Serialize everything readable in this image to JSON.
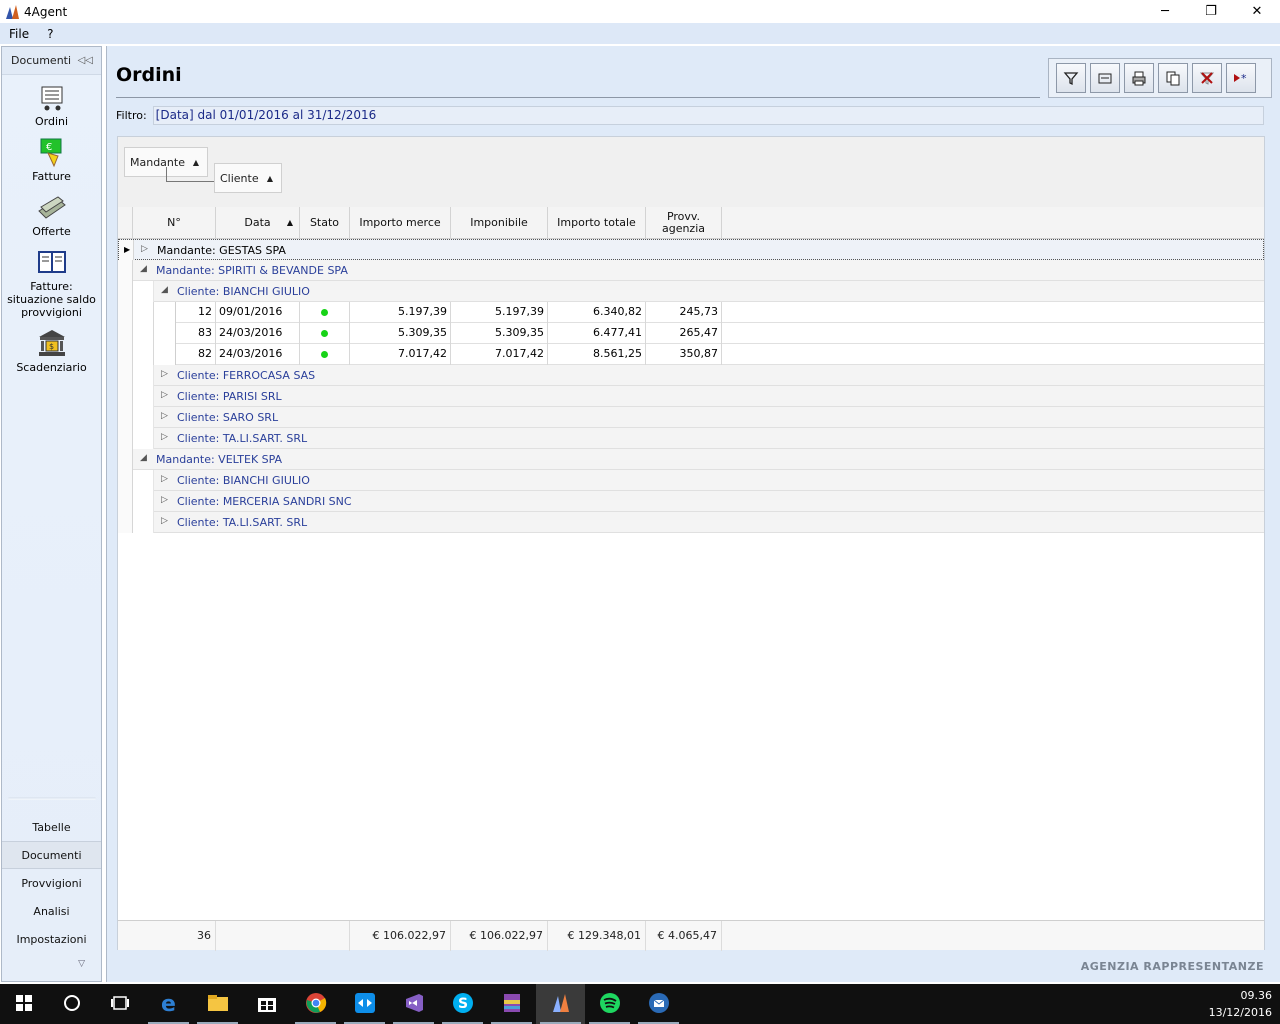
{
  "window": {
    "title": "4Agent",
    "controls": {
      "minimize": "─",
      "restore": "❐",
      "close": "✕"
    }
  },
  "menu": [
    {
      "label": "File"
    },
    {
      "label": "?"
    }
  ],
  "sidebar": {
    "header": "Documenti",
    "collapse_glyph": "◁◁",
    "big_items": [
      {
        "label": "Ordini",
        "icon": "cart-icon"
      },
      {
        "label": "Fatture",
        "icon": "money-icon"
      },
      {
        "label": "Offerte",
        "icon": "offers-icon"
      },
      {
        "label": "Fatture: situazione saldo provvigioni",
        "icon": "ledger-icon"
      },
      {
        "label": "Scadenziario",
        "icon": "bank-icon"
      }
    ],
    "small_items": [
      {
        "label": "Tabelle"
      },
      {
        "label": "Documenti"
      },
      {
        "label": "Provvigioni"
      },
      {
        "label": "Analisi"
      },
      {
        "label": "Impostazioni"
      }
    ],
    "more_glyph": "▽"
  },
  "page": {
    "title": "Ordini",
    "filter_label": "Filtro:",
    "filter_value": "[Data] dal 01/01/2016 al 31/12/2016",
    "toolbar": [
      {
        "name": "filter-icon",
        "glyph": "⛛"
      },
      {
        "name": "preview-icon",
        "glyph": "▭"
      },
      {
        "name": "print-icon",
        "glyph": "⎙"
      },
      {
        "name": "copy-icon",
        "glyph": "❐"
      },
      {
        "name": "delete-filter-icon",
        "glyph": "✗"
      },
      {
        "name": "new-icon",
        "glyph": "▸*"
      }
    ],
    "brand": "AGENZIA RAPPRESENTANZE"
  },
  "grid": {
    "group_chips": [
      {
        "label": "Mandante",
        "sort": "▲"
      },
      {
        "label": "Cliente",
        "sort": "▲"
      }
    ],
    "columns": [
      {
        "label": "N°"
      },
      {
        "label": "Data",
        "sort": "▲"
      },
      {
        "label": "Stato"
      },
      {
        "label": "Importo merce"
      },
      {
        "label": "Imponibile"
      },
      {
        "label": "Importo totale"
      },
      {
        "label": "Provv. agenzia"
      }
    ],
    "rows": [
      {
        "kind": "group1",
        "label": "Mandante: GESTAS SPA",
        "expander": "▷",
        "selected": true
      },
      {
        "kind": "group1",
        "label": "Mandante: SPIRITI & BEVANDE SPA",
        "expander": "◢"
      },
      {
        "kind": "group2",
        "label": "Cliente: BIANCHI GIULIO",
        "expander": "◢"
      },
      {
        "kind": "data",
        "n": "12",
        "data": "09/01/2016",
        "stato": "green",
        "merce": "5.197,39",
        "imponibile": "5.197,39",
        "totale": "6.340,82",
        "provv": "245,73"
      },
      {
        "kind": "data",
        "n": "83",
        "data": "24/03/2016",
        "stato": "green",
        "merce": "5.309,35",
        "imponibile": "5.309,35",
        "totale": "6.477,41",
        "provv": "265,47"
      },
      {
        "kind": "data",
        "n": "82",
        "data": "24/03/2016",
        "stato": "green",
        "merce": "7.017,42",
        "imponibile": "7.017,42",
        "totale": "8.561,25",
        "provv": "350,87"
      },
      {
        "kind": "group2",
        "label": "Cliente: FERROCASA SAS",
        "expander": "▷"
      },
      {
        "kind": "group2",
        "label": "Cliente: PARISI SRL",
        "expander": "▷"
      },
      {
        "kind": "group2",
        "label": "Cliente: SARO SRL",
        "expander": "▷"
      },
      {
        "kind": "group2",
        "label": "Cliente: TA.LI.SART. SRL",
        "expander": "▷"
      },
      {
        "kind": "group1",
        "label": "Mandante: VELTEK SPA",
        "expander": "◢"
      },
      {
        "kind": "group2",
        "label": "Cliente: BIANCHI GIULIO",
        "expander": "▷"
      },
      {
        "kind": "group2",
        "label": "Cliente: MERCERIA SANDRI SNC",
        "expander": "▷"
      },
      {
        "kind": "group2",
        "label": "Cliente: TA.LI.SART. SRL",
        "expander": "▷"
      }
    ],
    "footer": {
      "count": "36",
      "merce": "€ 106.022,97",
      "imponibile": "€ 106.022,97",
      "totale": "€ 129.348,01",
      "provv": "€ 4.065,47"
    },
    "colors": {
      "status_green": "#17d317",
      "group_text": "#2a3f9a"
    }
  },
  "taskbar": {
    "items": [
      {
        "name": "start-icon"
      },
      {
        "name": "search-icon"
      },
      {
        "name": "task-view-icon"
      },
      {
        "name": "edge-icon",
        "running": true
      },
      {
        "name": "explorer-icon",
        "running": true
      },
      {
        "name": "store-icon"
      },
      {
        "name": "chrome-icon",
        "running": true
      },
      {
        "name": "teamviewer-icon",
        "running": true
      },
      {
        "name": "visual-studio-icon",
        "running": true
      },
      {
        "name": "skype-icon",
        "running": true
      },
      {
        "name": "winrar-icon",
        "running": true
      },
      {
        "name": "4agent-icon",
        "running": true,
        "active": true
      },
      {
        "name": "spotify-icon",
        "running": true
      },
      {
        "name": "thunderbird-icon",
        "running": true
      }
    ],
    "time": "09.36",
    "date": "13/12/2016"
  }
}
